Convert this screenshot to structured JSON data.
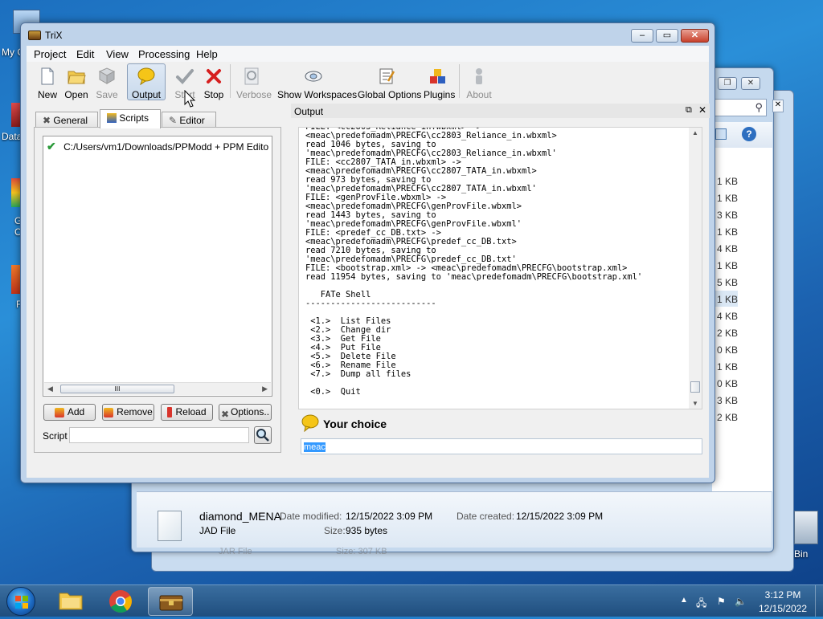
{
  "desktop": {
    "icon_labels": [
      "My C",
      "Data",
      "G",
      "C",
      "F",
      "Bin"
    ]
  },
  "background_window": {
    "sizes": [
      "1 KB",
      "1 KB",
      "3 KB",
      "1 KB",
      "4 KB",
      "1 KB",
      "5 KB",
      "1 KB",
      "4 KB",
      "2 KB",
      "0 KB",
      "1 KB",
      "0 KB",
      "3 KB",
      "2 KB"
    ],
    "details": {
      "file_name": "diamond_MENA",
      "file_type": "JAD File",
      "modified_label": "Date modified:",
      "modified_value": "12/15/2022 3:09 PM",
      "created_label": "Date created:",
      "created_value": "12/15/2022 3:09 PM",
      "size_label": "Size:",
      "size_value": "935 bytes",
      "next_type": "JAR File",
      "next_size": "Size: 307 KB"
    }
  },
  "window": {
    "title": "TriX",
    "menu": [
      "Project",
      "Edit",
      "View",
      "Processing",
      "Help"
    ],
    "toolbar": [
      {
        "label": "New",
        "icon": "new-document-icon",
        "enabled": true
      },
      {
        "label": "Open",
        "icon": "open-folder-icon",
        "enabled": true
      },
      {
        "label": "Save",
        "icon": "save-icon",
        "enabled": false
      },
      {
        "label": "Output",
        "icon": "speech-bubble-icon",
        "enabled": true,
        "pressed": true
      },
      {
        "label": "Start",
        "icon": "checkmark-icon",
        "enabled": false
      },
      {
        "label": "Stop",
        "icon": "red-x-icon",
        "enabled": true
      },
      {
        "label": "Verbose",
        "icon": "magnifier-doc-icon",
        "enabled": false
      },
      {
        "label": "Show Workspaces",
        "icon": "workspaces-icon",
        "enabled": true
      },
      {
        "label": "Global Options",
        "icon": "options-icon",
        "enabled": true
      },
      {
        "label": "Plugins",
        "icon": "plugins-icon",
        "enabled": true
      },
      {
        "label": "About",
        "icon": "about-icon",
        "enabled": false
      }
    ],
    "tabs": [
      "General",
      "Scripts",
      "Editor"
    ],
    "active_tab": "Scripts",
    "script_path": "C:/Users/vm1/Downloads/PPModd + PPM Edito",
    "scroll_thumb_text": "III",
    "buttons": {
      "add": "Add",
      "remove": "Remove",
      "reload": "Reload",
      "options": "Options.."
    },
    "script_label": "Script",
    "script_value": "",
    "output_title": "Output",
    "output_lines": "FILE: <cc2803_Reliance_in.wbxml> ->\n<meac\\predefomadm\\PRECFG\\cc2803_Reliance_in.wbxml>\nread 1046 bytes, saving to\n'meac\\predefomadm\\PRECFG\\cc2803_Reliance_in.wbxml'\nFILE: <cc2807_TATA_in.wbxml> ->\n<meac\\predefomadm\\PRECFG\\cc2807_TATA_in.wbxml>\nread 973 bytes, saving to\n'meac\\predefomadm\\PRECFG\\cc2807_TATA_in.wbxml'\nFILE: <genProvFile.wbxml> ->\n<meac\\predefomadm\\PRECFG\\genProvFile.wbxml>\nread 1443 bytes, saving to\n'meac\\predefomadm\\PRECFG\\genProvFile.wbxml'\nFILE: <predef_cc_DB.txt> ->\n<meac\\predefomadm\\PRECFG\\predef_cc_DB.txt>\nread 7210 bytes, saving to\n'meac\\predefomadm\\PRECFG\\predef_cc_DB.txt'\nFILE: <bootstrap.xml> -> <meac\\predefomadm\\PRECFG\\bootstrap.xml>\nread 11954 bytes, saving to 'meac\\predefomadm\\PRECFG\\bootstrap.xml'\n\n   FATe Shell\n--------------------------\n\n <1.>  List Files\n <2.>  Change dir\n <3.>  Get File\n <4.>  Put File\n <5.>  Delete File\n <6.>  Rename File\n <7.>  Dump all files\n\n <0.>  Quit",
    "choice_label": "Your choice",
    "choice_value": "meac"
  },
  "taskbar": {
    "time": "3:12 PM",
    "date": "12/15/2022"
  }
}
